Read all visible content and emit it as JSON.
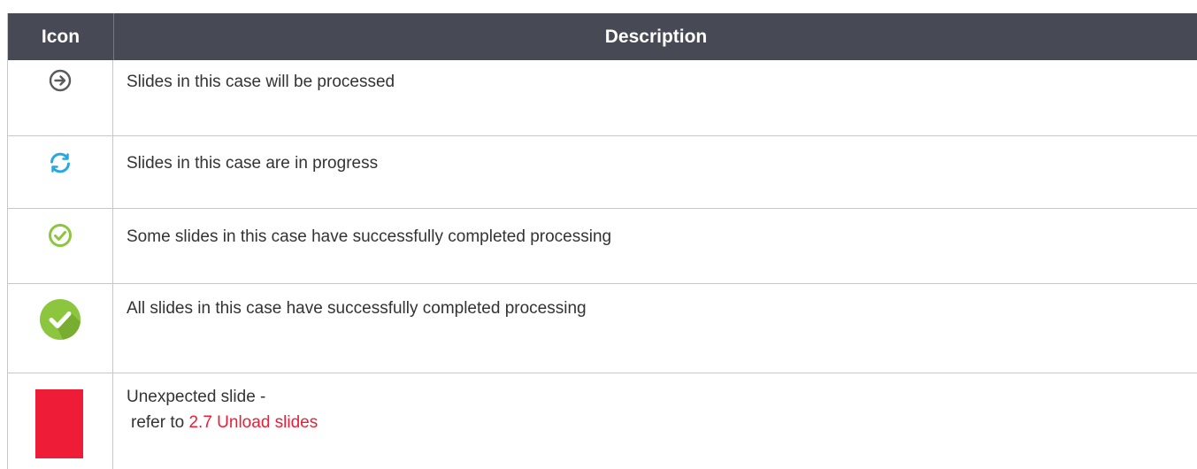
{
  "header": {
    "icon_col": "Icon",
    "desc_col": "Description"
  },
  "rows": [
    {
      "icon": "arrow-circle-icon",
      "description": "Slides in this case will be processed"
    },
    {
      "icon": "refresh-progress-icon",
      "description": "Slides in this case are in progress"
    },
    {
      "icon": "check-outline-icon",
      "description": "Some slides in this case have successfully completed processing"
    },
    {
      "icon": "check-filled-icon",
      "description": "All slides in this case have successfully completed processing"
    },
    {
      "icon": "red-square-icon",
      "description": "Unexpected slide -",
      "prefix": "refer to ",
      "link_text": "2.7 Unload slides"
    }
  ],
  "colors": {
    "header_bg": "#474a54",
    "accent_red": "#ee1c36",
    "green": "#8cc63f",
    "blue": "#29a8e0",
    "dark_gray": "#5a5a5a"
  }
}
